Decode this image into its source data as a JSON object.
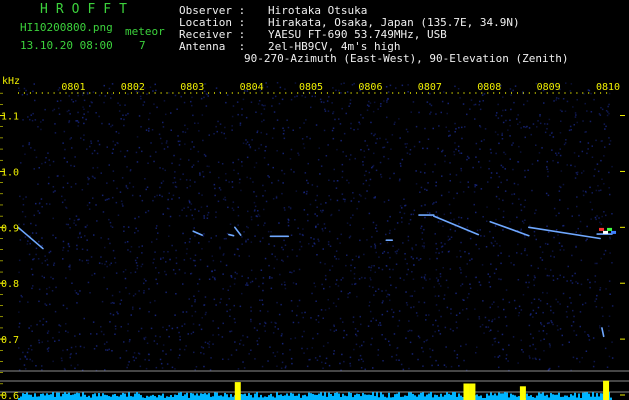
{
  "header": {
    "brand": "HROFFT",
    "filename": "HI10200800.png",
    "datetime": "13.10.20 08:00",
    "meteor_label": "meteor",
    "meteor_count": "7"
  },
  "info": {
    "observer_label": "Observer :",
    "observer": "Hirotaka Otsuka",
    "location_label": "Location :",
    "location": "Hirakata, Osaka, Japan (135.7E, 34.9N)",
    "receiver_label": "Receiver :",
    "receiver": "YAESU FT-690 53.749MHz, USB",
    "antenna_label": "Antenna  :",
    "antenna": "2el-HB9CV, 4m's high",
    "antenna_line2": "90-270-Azimuth (East-West), 90-Elevation (Zenith)"
  },
  "colors": {
    "background": "#000000",
    "grid_text": "#f0f000",
    "header_text": "#3cd23c",
    "noise": "#1a2a8c",
    "trace": "#6fa8ff",
    "bottom_bar": "#00b4ff",
    "bottom_peak": "#ffff00"
  },
  "chart_data": {
    "type": "spectrogram",
    "ylabel": "kHz",
    "x_ticks": [
      "0801",
      "0802",
      "0803",
      "0804",
      "0805",
      "0806",
      "0807",
      "0808",
      "0809",
      "0810"
    ],
    "y_ticks": [
      "1.1",
      "1.0",
      "0.9",
      "0.8",
      "0.7",
      "0.6"
    ],
    "ylim": [
      0.6,
      1.16
    ],
    "xlim": [
      0,
      10
    ],
    "meteor_traces": [
      {
        "x": [
          0.0,
          0.42
        ],
        "y": [
          0.9,
          0.862
        ]
      },
      {
        "x": [
          2.95,
          3.1
        ],
        "y": [
          0.893,
          0.886
        ]
      },
      {
        "x": [
          3.55,
          3.63
        ],
        "y": [
          0.887,
          0.885
        ]
      },
      {
        "x": [
          3.65,
          3.75
        ],
        "y": [
          0.9,
          0.886
        ]
      },
      {
        "x": [
          4.25,
          4.55
        ],
        "y": [
          0.884,
          0.884
        ]
      },
      {
        "x": [
          6.2,
          6.3
        ],
        "y": [
          0.877,
          0.877
        ]
      },
      {
        "x": [
          6.75,
          7.0
        ],
        "y": [
          0.922,
          0.922
        ]
      },
      {
        "x": [
          7.0,
          7.75
        ],
        "y": [
          0.92,
          0.887
        ]
      },
      {
        "x": [
          7.95,
          8.6
        ],
        "y": [
          0.91,
          0.885
        ]
      },
      {
        "x": [
          8.6,
          9.8
        ],
        "y": [
          0.9,
          0.88
        ]
      },
      {
        "x": [
          9.75,
          10.0
        ],
        "y": [
          0.888,
          0.888
        ]
      },
      {
        "x": [
          9.83,
          9.86
        ],
        "y": [
          0.72,
          0.705
        ]
      }
    ],
    "bottom_peaks": [
      {
        "x": 3.7,
        "level": 0.85
      },
      {
        "x": 7.55,
        "level": 0.75
      },
      {
        "x": 7.65,
        "level": 0.75
      },
      {
        "x": 8.5,
        "level": 0.55
      },
      {
        "x": 9.9,
        "level": 0.95
      }
    ]
  }
}
